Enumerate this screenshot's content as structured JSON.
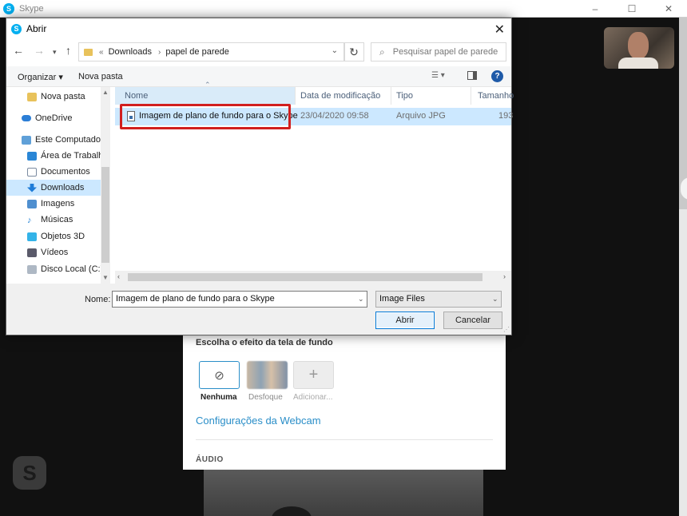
{
  "skype": {
    "title": "Skype",
    "window_controls": [
      "–",
      "☐",
      "✕"
    ],
    "logo_letter": "S"
  },
  "settings": {
    "background_heading": "Escolha o efeito da tela de fundo",
    "effects": [
      {
        "label": "Nenhuma",
        "symbol": "⊘"
      },
      {
        "label": "Desfoque"
      },
      {
        "label": "Adicionar...",
        "symbol": "+"
      }
    ],
    "webcam_link": "Configurações da Webcam",
    "audio_heading": "ÁUDIO"
  },
  "dialog": {
    "title": "Abrir",
    "close_symbol": "✕",
    "address": {
      "overflow": "«",
      "segments": [
        "Downloads",
        "papel de parede"
      ],
      "separator": "›"
    },
    "search_placeholder": "Pesquisar papel de parede",
    "toolbar": {
      "organize": "Organizar ▾",
      "new_folder": "Nova pasta",
      "help": "?"
    },
    "nav_items": [
      {
        "label": "Nova pasta",
        "icon": "folder-icon"
      },
      {
        "label": "OneDrive",
        "icon": "cloud-icon"
      },
      {
        "label": "Este Computador",
        "icon": "computer-icon"
      },
      {
        "label": "Área de Trabalho",
        "icon": "desktop-icon"
      },
      {
        "label": "Documentos",
        "icon": "documents-icon"
      },
      {
        "label": "Downloads",
        "icon": "download-icon"
      },
      {
        "label": "Imagens",
        "icon": "images-icon"
      },
      {
        "label": "Músicas",
        "icon": "music-icon"
      },
      {
        "label": "Objetos 3D",
        "icon": "cube-icon"
      },
      {
        "label": "Vídeos",
        "icon": "video-icon"
      },
      {
        "label": "Disco Local (C:)",
        "icon": "disk-icon"
      }
    ],
    "columns": [
      "Nome",
      "Data de modificação",
      "Tipo",
      "Tamanho"
    ],
    "files": [
      {
        "name": "Imagem de plano de fundo para o Skype",
        "date": "23/04/2020 09:58",
        "type": "Arquivo JPG",
        "size": "193"
      }
    ],
    "filename_label": "Nome:",
    "filename_value": "Imagem de plano de fundo para o Skype",
    "filetype_value": "Image Files",
    "open_button": "Abrir",
    "cancel_button": "Cancelar"
  },
  "colors": {
    "accent": "#0078d7",
    "selection": "#cce8ff",
    "highlight_border": "#d11f1f",
    "skype_blue": "#00aff0",
    "link": "#2a8ec8"
  }
}
